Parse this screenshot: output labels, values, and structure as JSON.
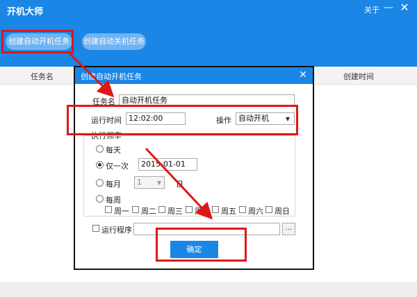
{
  "app": {
    "title": "开机大师",
    "about": "关于",
    "minimize_glyph": "—",
    "close_glyph": "✕",
    "create_startup_label": "创建自动开机任务",
    "create_shutdown_label": "创建自动关机任务",
    "columns": [
      "任务名",
      "创建时间"
    ]
  },
  "dialog": {
    "title": "创建自动开机任务",
    "close_glyph": "✕",
    "task_name_label": "任务名",
    "task_name_value": "自动开机任务",
    "run_time_label": "运行时间",
    "run_time_value": "12:02:00",
    "action_label": "操作",
    "action_value": "自动开机",
    "frequency_label": "执行频率",
    "freq_daily": "每天",
    "freq_once": "仅一次",
    "freq_once_selected": true,
    "once_date_value": "2015-01-01",
    "freq_monthly": "每月",
    "monthly_day_value": "1",
    "monthly_day_unit": "日",
    "freq_weekly": "每周",
    "weekdays": [
      "周一",
      "周二",
      "周三",
      "周四",
      "周五",
      "周六",
      "周日"
    ],
    "run_program_label": "运行程序",
    "run_program_value": "",
    "browse_label": "...",
    "ok_label": "确定"
  },
  "colors": {
    "accent": "#1a86e6",
    "annotation_red": "#e01616"
  }
}
